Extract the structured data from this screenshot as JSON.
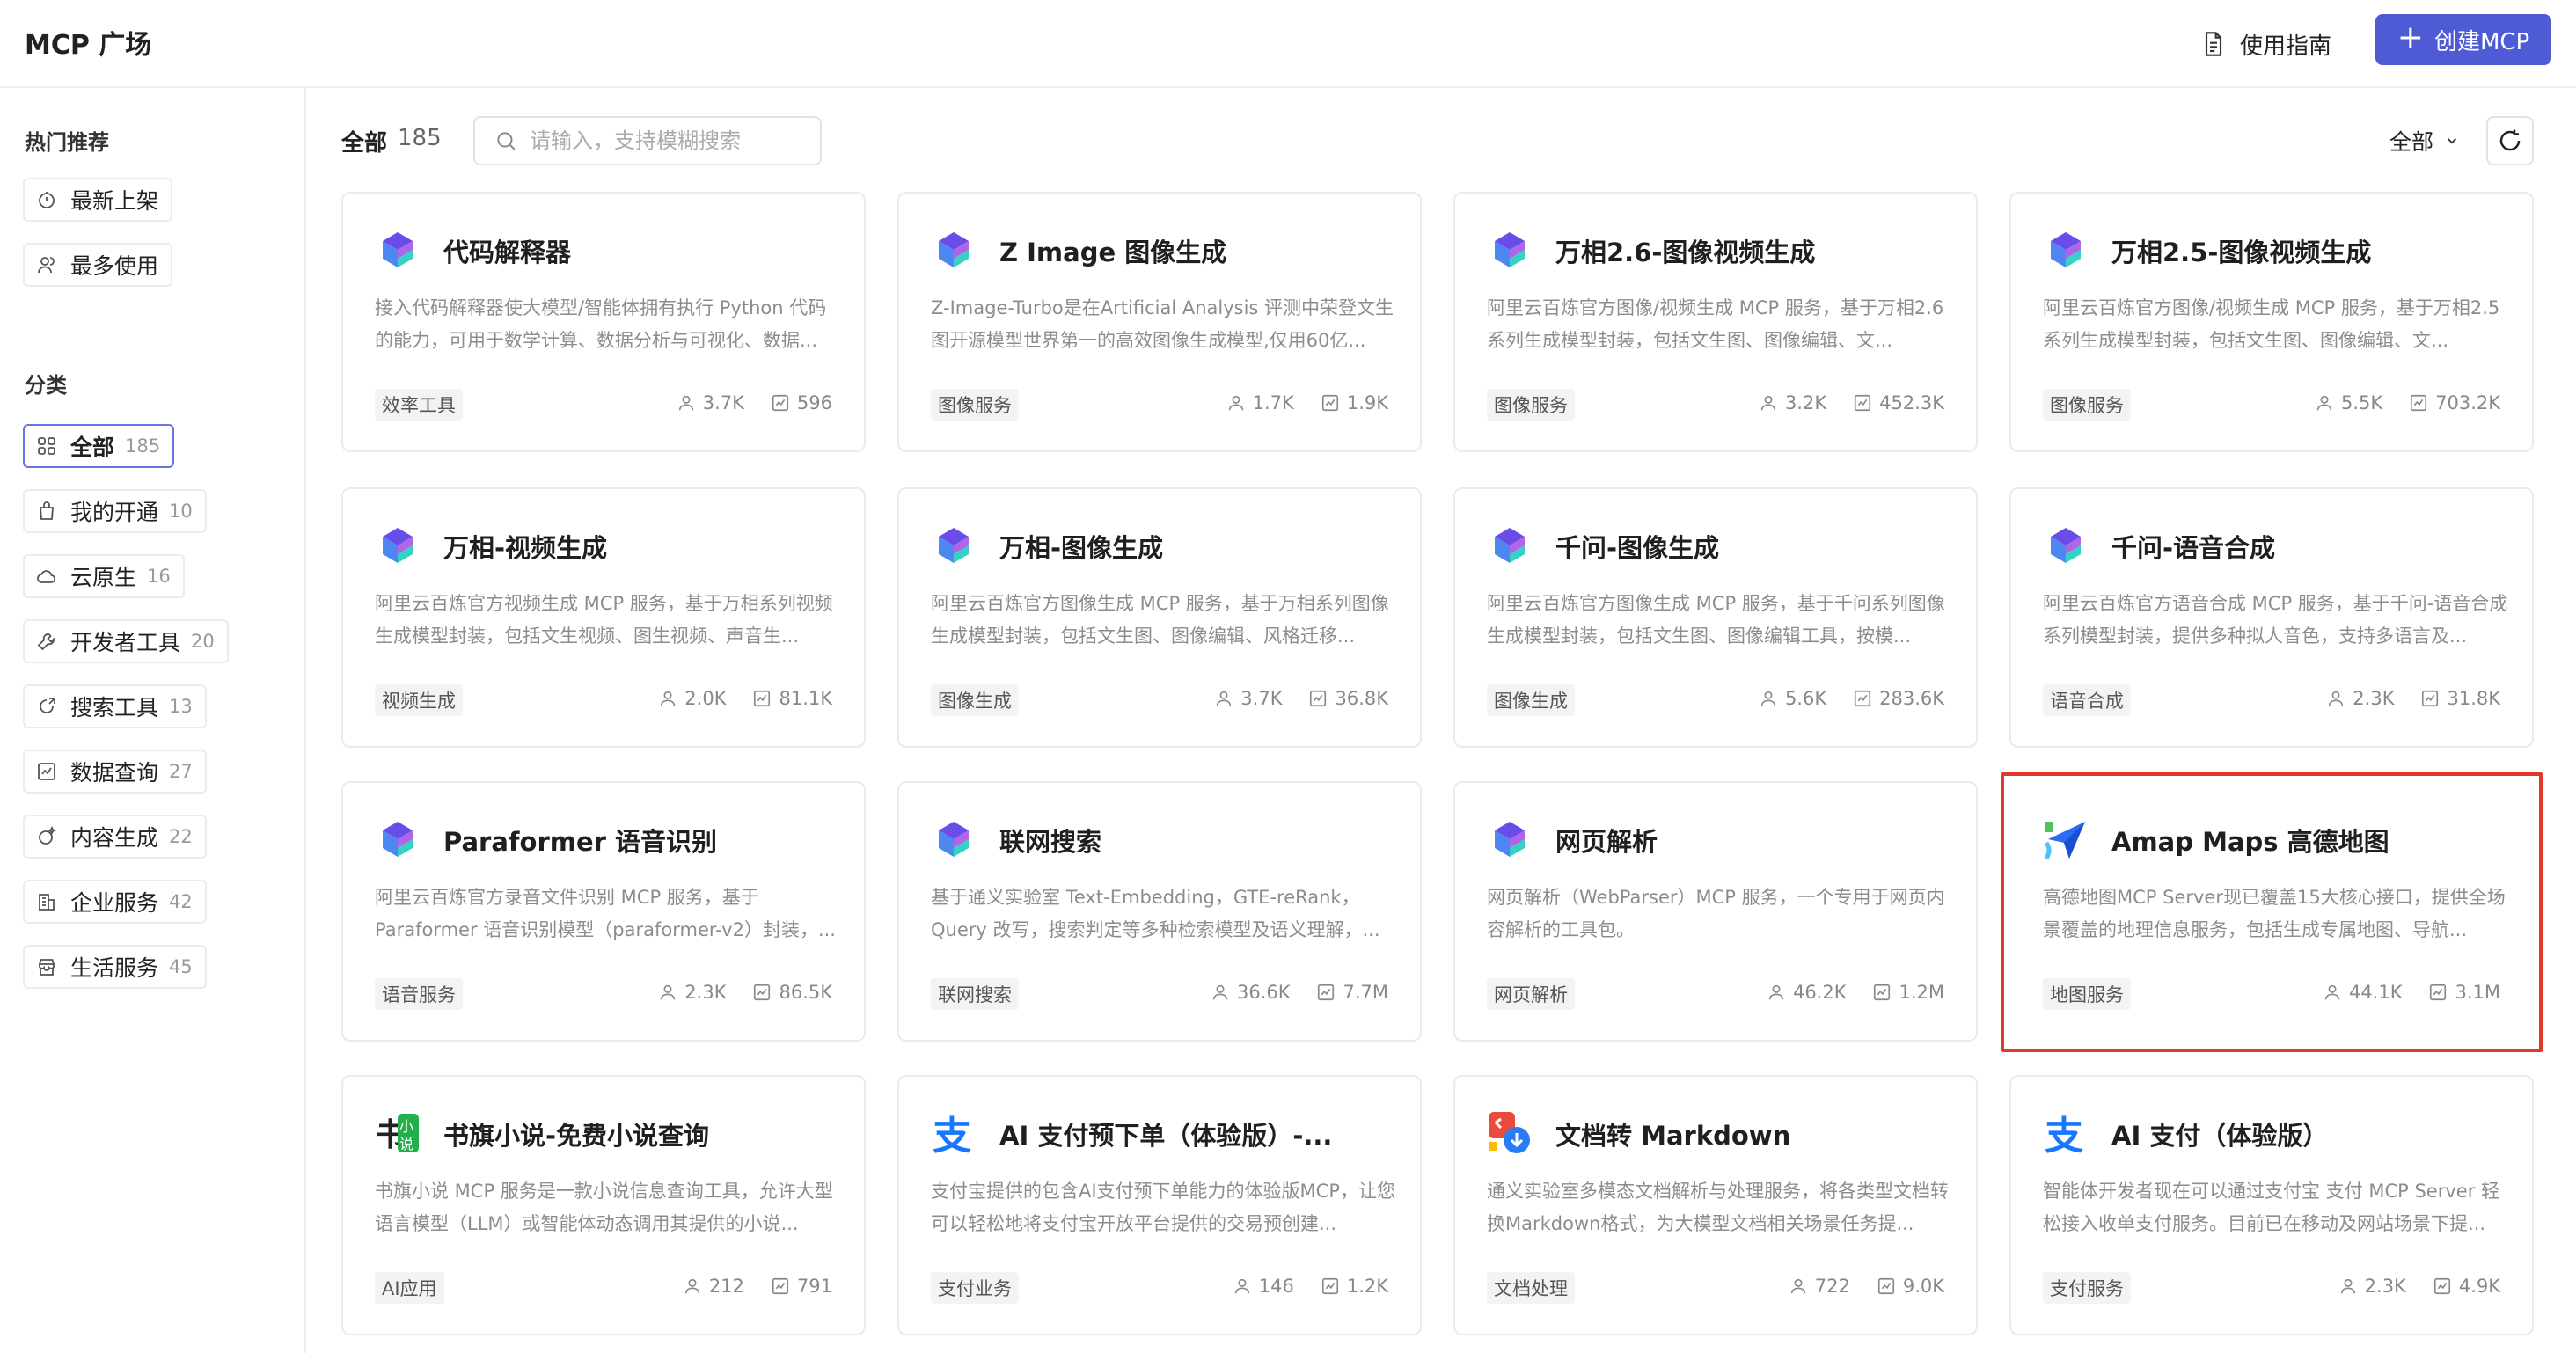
{
  "header": {
    "title": "MCP 广场",
    "guide_label": "使用指南",
    "create_label": "创建MCP",
    "accent_color": "#4f5bd5"
  },
  "sidebar": {
    "hot_title": "热门推荐",
    "hot_items": [
      {
        "label": "最新上架",
        "icon": "clock-icon"
      },
      {
        "label": "最多使用",
        "icon": "users-icon"
      }
    ],
    "category_title": "分类",
    "categories": [
      {
        "label": "全部",
        "count": "185",
        "icon": "grid-icon",
        "active": true
      },
      {
        "label": "我的开通",
        "count": "10",
        "icon": "bag-icon"
      },
      {
        "label": "云原生",
        "count": "16",
        "icon": "cloud-icon"
      },
      {
        "label": "开发者工具",
        "count": "20",
        "icon": "wrench-icon"
      },
      {
        "label": "搜索工具",
        "count": "13",
        "icon": "search-tool-icon"
      },
      {
        "label": "数据查询",
        "count": "27",
        "icon": "chart-icon"
      },
      {
        "label": "内容生成",
        "count": "22",
        "icon": "sparkle-icon"
      },
      {
        "label": "企业服务",
        "count": "42",
        "icon": "building-icon"
      },
      {
        "label": "生活服务",
        "count": "45",
        "icon": "store-icon"
      }
    ]
  },
  "toolbar": {
    "all_label": "全部",
    "all_count": "185",
    "search_placeholder": "请输入，支持模糊搜索",
    "filter_value": "全部"
  },
  "cards": [
    {
      "name": "代码解释器",
      "desc": "接入代码解释器使大模型/智能体拥有执行 Python 代码的能力，可用于数学计算、数据分析与可视化、数据...",
      "tag": "效率工具",
      "users": "3.7K",
      "calls": "596",
      "logo": "bailian-logo-icon"
    },
    {
      "name": "Z Image 图像生成",
      "desc": "Z-Image-Turbo是在Artificial Analysis 评测中荣登文生图开源模型世界第一的高效图像生成模型,仅用60亿...",
      "tag": "图像服务",
      "users": "1.7K",
      "calls": "1.9K",
      "logo": "bailian-logo-icon"
    },
    {
      "name": "万相2.6-图像视频生成",
      "desc": "阿里云百炼官方图像/视频生成 MCP 服务，基于万相2.6系列生成模型封装，包括文生图、图像编辑、文...",
      "tag": "图像服务",
      "users": "3.2K",
      "calls": "452.3K",
      "logo": "bailian-logo-icon"
    },
    {
      "name": "万相2.5-图像视频生成",
      "desc": "阿里云百炼官方图像/视频生成 MCP 服务，基于万相2.5系列生成模型封装，包括文生图、图像编辑、文...",
      "tag": "图像服务",
      "users": "5.5K",
      "calls": "703.2K",
      "logo": "bailian-logo-icon"
    },
    {
      "name": "万相-视频生成",
      "desc": "阿里云百炼官方视频生成 MCP 服务，基于万相系列视频生成模型封装，包括文生视频、图生视频、声音生...",
      "tag": "视频生成",
      "users": "2.0K",
      "calls": "81.1K",
      "logo": "bailian-logo-icon"
    },
    {
      "name": "万相-图像生成",
      "desc": "阿里云百炼官方图像生成 MCP 服务，基于万相系列图像生成模型封装，包括文生图、图像编辑、风格迁移...",
      "tag": "图像生成",
      "users": "3.7K",
      "calls": "36.8K",
      "logo": "bailian-logo-icon"
    },
    {
      "name": "千问-图像生成",
      "desc": "阿里云百炼官方图像生成 MCP 服务，基于千问系列图像生成模型封装，包括文生图、图像编辑工具，按模...",
      "tag": "图像生成",
      "users": "5.6K",
      "calls": "283.6K",
      "logo": "bailian-logo-icon"
    },
    {
      "name": "千问-语音合成",
      "desc": "阿里云百炼官方语音合成 MCP 服务，基于千问-语音合成系列模型封装，提供多种拟人音色，支持多语言及...",
      "tag": "语音合成",
      "users": "2.3K",
      "calls": "31.8K",
      "logo": "bailian-logo-icon"
    },
    {
      "name": "Paraformer 语音识别",
      "desc": "阿里云百炼官方录音文件识别 MCP 服务，基于Paraformer 语音识别模型（paraformer-v2）封装，...",
      "tag": "语音服务",
      "users": "2.3K",
      "calls": "86.5K",
      "logo": "bailian-logo-icon"
    },
    {
      "name": "联网搜索",
      "desc": "基于通义实验室 Text-Embedding，GTE-reRank，Query 改写，搜索判定等多种检索模型及语义理解，...",
      "tag": "联网搜索",
      "users": "36.6K",
      "calls": "7.7M",
      "logo": "bailian-logo-icon"
    },
    {
      "name": "网页解析",
      "desc": "网页解析（WebParser）MCP 服务，一个专用于网页内容解析的工具包。",
      "tag": "网页解析",
      "users": "46.2K",
      "calls": "1.2M",
      "logo": "bailian-logo-icon"
    },
    {
      "name": "Amap Maps 高德地图",
      "desc": "高德地图MCP Server现已覆盖15大核心接口，提供全场景覆盖的地理信息服务，包括生成专属地图、导航...",
      "tag": "地图服务",
      "users": "44.1K",
      "calls": "3.1M",
      "logo": "amap-logo-icon",
      "highlight": true
    },
    {
      "name": "书旗小说-免费小说查询",
      "desc": "书旗小说 MCP 服务是一款小说信息查询工具，允许大型语言模型（LLM）或智能体动态调用其提供的小说...",
      "tag": "AI应用",
      "users": "212",
      "calls": "791",
      "logo": "shuqi-logo-icon"
    },
    {
      "name": "AI 支付预下单（体验版）-...",
      "desc": "支付宝提供的包含AI支付预下单能力的体验版MCP，让您可以轻松地将支付宝开放平台提供的交易预创建...",
      "tag": "支付业务",
      "users": "146",
      "calls": "1.2K",
      "logo": "alipay-logo-icon"
    },
    {
      "name": "文档转 Markdown",
      "desc": "通义实验室多模态文档解析与处理服务，将各类型文档转换Markdown格式，为大模型文档相关场景任务提...",
      "tag": "文档处理",
      "users": "722",
      "calls": "9.0K",
      "logo": "doc-logo-icon"
    },
    {
      "name": "AI 支付（体验版）",
      "desc": "智能体开发者现在可以通过支付宝 支付 MCP Server 轻松接入收单支付服务。目前已在移动及网站场景下提...",
      "tag": "支付服务",
      "users": "2.3K",
      "calls": "4.9K",
      "logo": "alipay-logo-icon"
    }
  ]
}
